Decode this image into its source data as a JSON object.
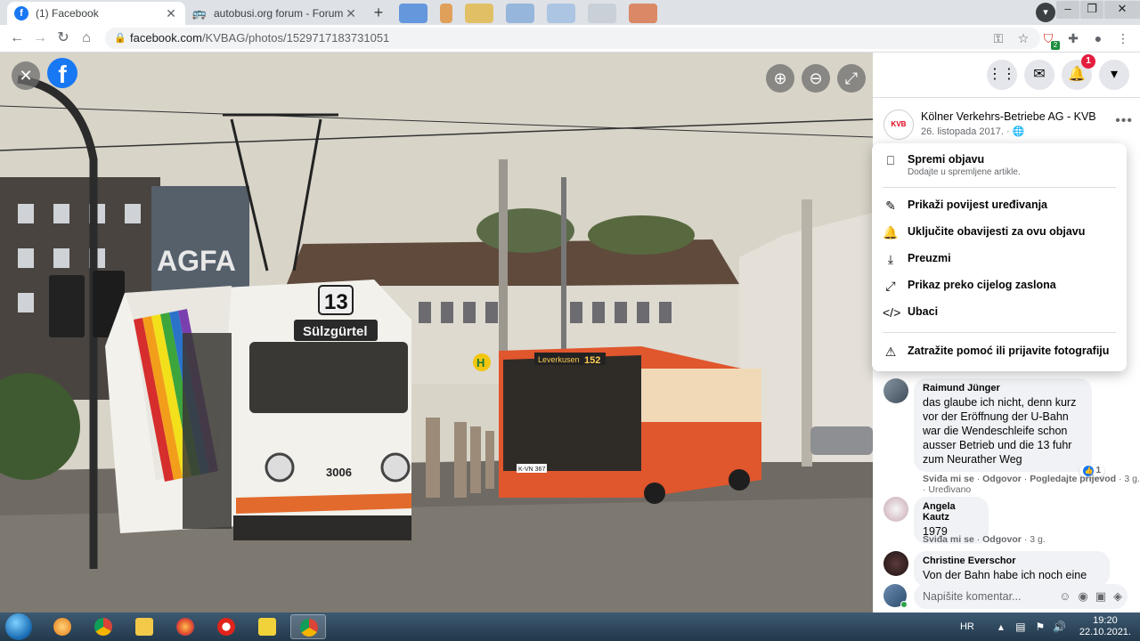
{
  "browser": {
    "tabs": [
      {
        "title": "(1) Facebook",
        "favicon": "f",
        "favicon_color": "#1877f2",
        "active": true
      },
      {
        "title": "autobusi.org forum - Forum o au",
        "favicon": "bus",
        "favicon_color": "#5f6368",
        "active": false
      }
    ],
    "url_host": "facebook.com",
    "url_path": "/KVBAG/photos/1529717183731051",
    "extension_badge": "2"
  },
  "viewer": {
    "photo_texts": {
      "route_number": "13",
      "destination": "Sülzgürtel",
      "tram_number": "3006",
      "sign_agfa": "AGFA",
      "bus_destination": "Leverkusen",
      "bus_route": "152",
      "bus_plate": "K-VN 367",
      "stop_sign": "H"
    }
  },
  "panel": {
    "notifications_count": "1",
    "post": {
      "page_name": "Kölner Verkehrs-Betriebe AG - KVB",
      "date": "26. listopada 2017. ·",
      "avatar_text": "KVB"
    },
    "menu": {
      "items": [
        {
          "label": "Spremi objavu",
          "sub": "Dodajte u spremljene artikle.",
          "icon": "bookmark-icon"
        },
        {
          "label": "Prikaži povijest uređivanja",
          "icon": "edit-history-icon"
        },
        {
          "label": "Uključite obavijesti za ovu objavu",
          "icon": "bell-icon"
        },
        {
          "label": "Preuzmi",
          "icon": "download-icon"
        },
        {
          "label": "Prikaz preko cijelog zaslona",
          "icon": "fullscreen-icon"
        },
        {
          "label": "Ubaci",
          "icon": "embed-icon"
        },
        {
          "label": "Zatražite pomoć ili prijavite fotografiju",
          "icon": "report-icon"
        }
      ]
    },
    "comments": [
      {
        "name": "Raimund Jünger",
        "lines": [
          "das glaube ich nicht, denn kurz",
          "vor der Eröffnung der U-Bahn",
          "war die Wendeschleife schon",
          "ausser Betrieb und die 13 fuhr",
          "zum Neurather Weg"
        ],
        "likes": "1",
        "like": "Sviđa mi se",
        "sep1": "·",
        "reply": "Odgovor",
        "sep2": "·",
        "translate": "Pogledajte prijevod",
        "sep3": "·",
        "time": "3 g.",
        "edited": "· Uređivano"
      },
      {
        "name": "Angela Kautz",
        "lines": [
          "1979"
        ],
        "like": "Sviđa mi se",
        "sep1": "·",
        "reply": "Odgovor",
        "sep2": "·",
        "time": "3 g."
      },
      {
        "name": "Christine Everschor",
        "lines": [
          "Von der Bahn habe ich noch eine"
        ]
      }
    ],
    "composer_placeholder": "Napišite komentar..."
  },
  "taskbar": {
    "lang": "HR",
    "time": "19:20",
    "date": "22.10.2021."
  },
  "colors": {
    "facebook_blue": "#1877f2",
    "notification_red": "#e41e3f",
    "kvb_red": "#e2001a"
  }
}
